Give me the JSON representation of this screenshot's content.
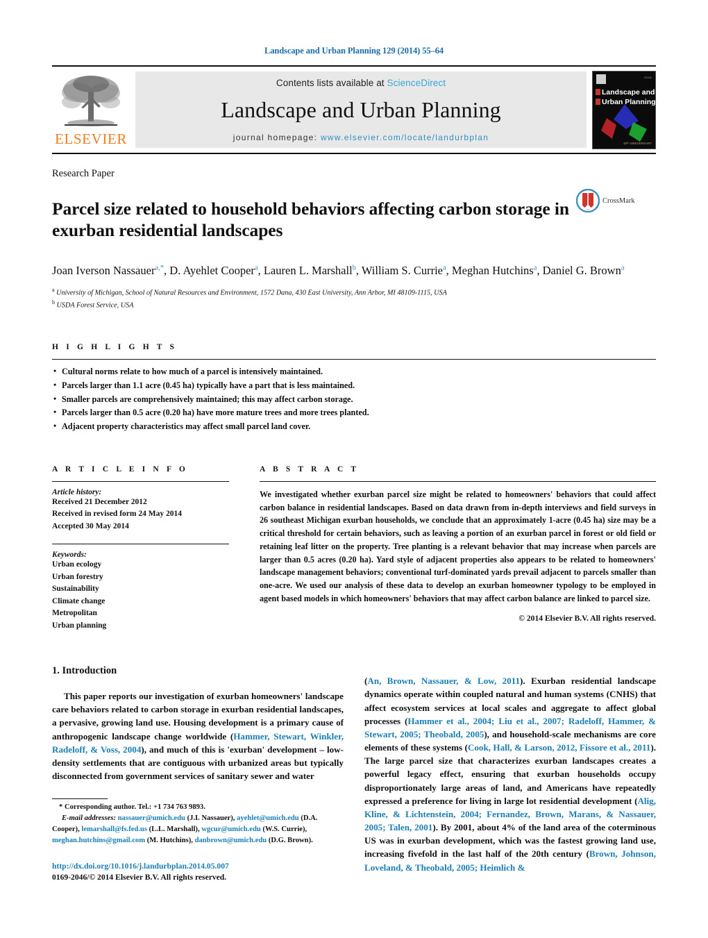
{
  "running_head": "Landscape and Urban Planning 129 (2014) 55–64",
  "masthead": {
    "publisher_name": "ELSEVIER",
    "contents_prefix": "Contents lists available at ",
    "contents_link": "ScienceDirect",
    "journal_title": "Landscape and Urban Planning",
    "homepage_prefix": "journal homepage:",
    "homepage_url": "www.elsevier.com/locate/landurbplan",
    "cover": {
      "line1": "Landscape and",
      "line2": "Urban Planning",
      "anniversary": "40ᵗʰ ANNIVERSARY"
    },
    "colors": {
      "link_blue": "#3ba6d8",
      "elsevier_orange": "#ef7d20",
      "panel_gray": "#e8e8e8"
    }
  },
  "article": {
    "type_label": "Research Paper",
    "title": "Parcel size related to household behaviors affecting carbon storage in exurban residential landscapes",
    "crossmark_label": "CrossMark",
    "authors_html": "Joan Iverson Nassauer<sup>a,*</sup>, D. Ayehlet Cooper<sup>a</sup>, Lauren L. Marshall<sup>b</sup>, William S. Currie<sup>a</sup>, Meghan Hutchins<sup>a</sup>, Daniel G. Brown<sup>a</sup>",
    "affiliations": [
      {
        "marker": "a",
        "text": "University of Michigan, School of Natural Resources and Environment, 1572 Dana, 430 East University, Ann Arbor, MI 48109-1115, USA"
      },
      {
        "marker": "b",
        "text": "USDA Forest Service, USA"
      }
    ]
  },
  "highlights": {
    "label": "H I G H L I G H T S",
    "items": [
      "Cultural norms relate to how much of a parcel is intensively maintained.",
      "Parcels larger than 1.1 acre (0.45 ha) typically have a part that is less maintained.",
      "Smaller parcels are comprehensively maintained; this may affect carbon storage.",
      "Parcels larger than 0.5 acre (0.20 ha) have more mature trees and more trees planted.",
      "Adjacent property characteristics may affect small parcel land cover."
    ]
  },
  "article_info": {
    "label": "A R T I C L E  I N F O",
    "history_label": "Article history:",
    "history": [
      "Received 21 December 2012",
      "Received in revised form 24 May 2014",
      "Accepted 30 May 2014"
    ],
    "keywords_label": "Keywords:",
    "keywords": [
      "Urban ecology",
      "Urban forestry",
      "Sustainability",
      "Climate change",
      "Metropolitan",
      "Urban planning"
    ]
  },
  "abstract": {
    "label": "A B S T R A C T",
    "text": "We investigated whether exurban parcel size might be related to homeowners' behaviors that could affect carbon balance in residential landscapes. Based on data drawn from in-depth interviews and field surveys in 26 southeast Michigan exurban households, we conclude that an approximately 1-acre (0.45 ha) size may be a critical threshold for certain behaviors, such as leaving a portion of an exurban parcel in forest or old field or retaining leaf litter on the property. Tree planting is a relevant behavior that may increase when parcels are larger than 0.5 acres (0.20 ha). Yard style of adjacent properties also appears to be related to homeowners' landscape management behaviors; conventional turf-dominated yards prevail adjacent to parcels smaller than one-acre. We used our analysis of these data to develop an exurban homeowner typology to be employed in agent based models in which homeowners' behaviors that may affect carbon balance are linked to parcel size.",
    "copyright": "© 2014 Elsevier B.V. All rights reserved."
  },
  "body": {
    "section_number_title": "1.  Introduction",
    "left_paragraph_html": "This paper reports our investigation of exurban homeowners' landscape care behaviors related to carbon storage in exurban residential landscapes, a pervasive, growing land use. Housing development is a primary cause of anthropogenic landscape change worldwide (<span class=\"ref\">Hammer, Stewart, Winkler, Radeloff, &amp; Voss, 2004</span>), and much of this is 'exurban' development – low-density settlements that are contiguous with urbanized areas but typically disconnected from government services of sanitary sewer and water",
    "right_paragraph_html": "(<span class=\"ref\">An, Brown, Nassauer, &amp; Low, 2011</span>). Exurban residential landscape dynamics operate within coupled natural and human systems (CNHS) that affect ecosystem services at local scales and aggregate to affect global processes (<span class=\"ref\">Hammer et al., 2004; Liu et al., 2007; Radeloff, Hammer, &amp; Stewart, 2005; Theobald, 2005</span>), and household-scale mechanisms are core elements of these systems (<span class=\"ref\">Cook, Hall, &amp; Larson, 2012, Fissore et al., 2011</span>). The large parcel size that characterizes exurban landscapes creates a powerful legacy effect, ensuring that exurban households occupy disproportionately large areas of land, and Americans have repeatedly expressed a preference for living in large lot residential development (<span class=\"ref\">Alig, Kline, &amp; Lichtenstein, 2004; Fernandez, Brown, Marans, &amp; Nassauer, 2005; Talen, 2001</span>). By 2001, about 4% of the land area of the coterminous US was in exurban development, which was the fastest growing land use, increasing fivefold in the last half of the 20th century (<span class=\"ref\">Brown, Johnson, Loveland, &amp; Theobald, 2005; Heimlich &amp;</span>"
  },
  "footnote": {
    "corresponding_html": "* Corresponding author. Tel.: +1 734 763 9893.",
    "emails_html": "<span class=\"em\">E-mail addresses:</span> <span class=\"lnk\">nassauer@umich.edu</span> (J.I. Nassauer), <span class=\"lnk\">ayehlet@umich.edu</span> (D.A. Cooper), <span class=\"lnk\">lemarshall@fs.fed.us</span> (L.L. Marshall), <span class=\"lnk\">wgcur@umich.edu</span> (W.S. Currie), <span class=\"lnk\">meghan.hutchins@gmail.com</span> (M. Hutchins), <span class=\"lnk\">danbrown@umich.edu</span> (D.G. Brown).",
    "doi": "http://dx.doi.org/10.1016/j.landurbplan.2014.05.007",
    "issn_line": "0169-2046/© 2014 Elsevier B.V. All rights reserved."
  }
}
